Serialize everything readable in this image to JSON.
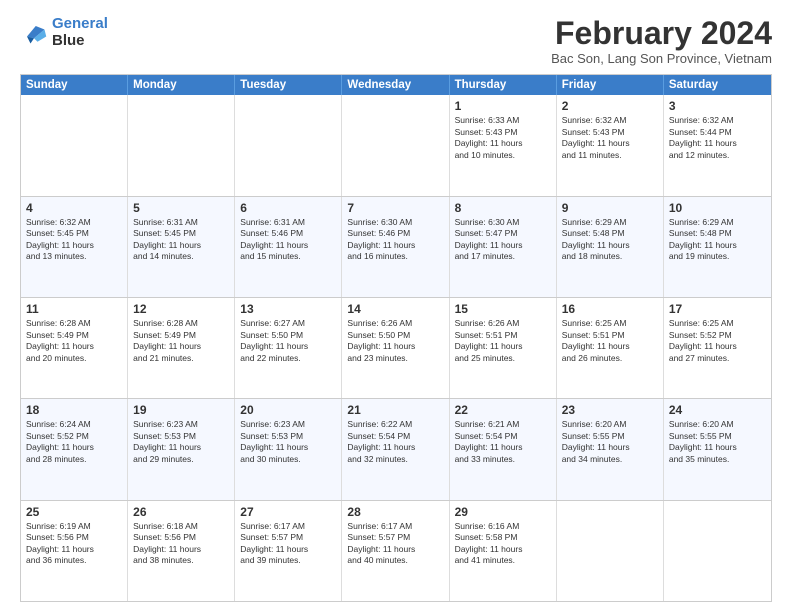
{
  "header": {
    "logo_line1": "General",
    "logo_line2": "Blue",
    "month_title": "February 2024",
    "location": "Bac Son, Lang Son Province, Vietnam"
  },
  "weekdays": [
    "Sunday",
    "Monday",
    "Tuesday",
    "Wednesday",
    "Thursday",
    "Friday",
    "Saturday"
  ],
  "rows": [
    [
      {
        "day": "",
        "info": ""
      },
      {
        "day": "",
        "info": ""
      },
      {
        "day": "",
        "info": ""
      },
      {
        "day": "",
        "info": ""
      },
      {
        "day": "1",
        "info": "Sunrise: 6:33 AM\nSunset: 5:43 PM\nDaylight: 11 hours\nand 10 minutes."
      },
      {
        "day": "2",
        "info": "Sunrise: 6:32 AM\nSunset: 5:43 PM\nDaylight: 11 hours\nand 11 minutes."
      },
      {
        "day": "3",
        "info": "Sunrise: 6:32 AM\nSunset: 5:44 PM\nDaylight: 11 hours\nand 12 minutes."
      }
    ],
    [
      {
        "day": "4",
        "info": "Sunrise: 6:32 AM\nSunset: 5:45 PM\nDaylight: 11 hours\nand 13 minutes."
      },
      {
        "day": "5",
        "info": "Sunrise: 6:31 AM\nSunset: 5:45 PM\nDaylight: 11 hours\nand 14 minutes."
      },
      {
        "day": "6",
        "info": "Sunrise: 6:31 AM\nSunset: 5:46 PM\nDaylight: 11 hours\nand 15 minutes."
      },
      {
        "day": "7",
        "info": "Sunrise: 6:30 AM\nSunset: 5:46 PM\nDaylight: 11 hours\nand 16 minutes."
      },
      {
        "day": "8",
        "info": "Sunrise: 6:30 AM\nSunset: 5:47 PM\nDaylight: 11 hours\nand 17 minutes."
      },
      {
        "day": "9",
        "info": "Sunrise: 6:29 AM\nSunset: 5:48 PM\nDaylight: 11 hours\nand 18 minutes."
      },
      {
        "day": "10",
        "info": "Sunrise: 6:29 AM\nSunset: 5:48 PM\nDaylight: 11 hours\nand 19 minutes."
      }
    ],
    [
      {
        "day": "11",
        "info": "Sunrise: 6:28 AM\nSunset: 5:49 PM\nDaylight: 11 hours\nand 20 minutes."
      },
      {
        "day": "12",
        "info": "Sunrise: 6:28 AM\nSunset: 5:49 PM\nDaylight: 11 hours\nand 21 minutes."
      },
      {
        "day": "13",
        "info": "Sunrise: 6:27 AM\nSunset: 5:50 PM\nDaylight: 11 hours\nand 22 minutes."
      },
      {
        "day": "14",
        "info": "Sunrise: 6:26 AM\nSunset: 5:50 PM\nDaylight: 11 hours\nand 23 minutes."
      },
      {
        "day": "15",
        "info": "Sunrise: 6:26 AM\nSunset: 5:51 PM\nDaylight: 11 hours\nand 25 minutes."
      },
      {
        "day": "16",
        "info": "Sunrise: 6:25 AM\nSunset: 5:51 PM\nDaylight: 11 hours\nand 26 minutes."
      },
      {
        "day": "17",
        "info": "Sunrise: 6:25 AM\nSunset: 5:52 PM\nDaylight: 11 hours\nand 27 minutes."
      }
    ],
    [
      {
        "day": "18",
        "info": "Sunrise: 6:24 AM\nSunset: 5:52 PM\nDaylight: 11 hours\nand 28 minutes."
      },
      {
        "day": "19",
        "info": "Sunrise: 6:23 AM\nSunset: 5:53 PM\nDaylight: 11 hours\nand 29 minutes."
      },
      {
        "day": "20",
        "info": "Sunrise: 6:23 AM\nSunset: 5:53 PM\nDaylight: 11 hours\nand 30 minutes."
      },
      {
        "day": "21",
        "info": "Sunrise: 6:22 AM\nSunset: 5:54 PM\nDaylight: 11 hours\nand 32 minutes."
      },
      {
        "day": "22",
        "info": "Sunrise: 6:21 AM\nSunset: 5:54 PM\nDaylight: 11 hours\nand 33 minutes."
      },
      {
        "day": "23",
        "info": "Sunrise: 6:20 AM\nSunset: 5:55 PM\nDaylight: 11 hours\nand 34 minutes."
      },
      {
        "day": "24",
        "info": "Sunrise: 6:20 AM\nSunset: 5:55 PM\nDaylight: 11 hours\nand 35 minutes."
      }
    ],
    [
      {
        "day": "25",
        "info": "Sunrise: 6:19 AM\nSunset: 5:56 PM\nDaylight: 11 hours\nand 36 minutes."
      },
      {
        "day": "26",
        "info": "Sunrise: 6:18 AM\nSunset: 5:56 PM\nDaylight: 11 hours\nand 38 minutes."
      },
      {
        "day": "27",
        "info": "Sunrise: 6:17 AM\nSunset: 5:57 PM\nDaylight: 11 hours\nand 39 minutes."
      },
      {
        "day": "28",
        "info": "Sunrise: 6:17 AM\nSunset: 5:57 PM\nDaylight: 11 hours\nand 40 minutes."
      },
      {
        "day": "29",
        "info": "Sunrise: 6:16 AM\nSunset: 5:58 PM\nDaylight: 11 hours\nand 41 minutes."
      },
      {
        "day": "",
        "info": ""
      },
      {
        "day": "",
        "info": ""
      }
    ]
  ]
}
